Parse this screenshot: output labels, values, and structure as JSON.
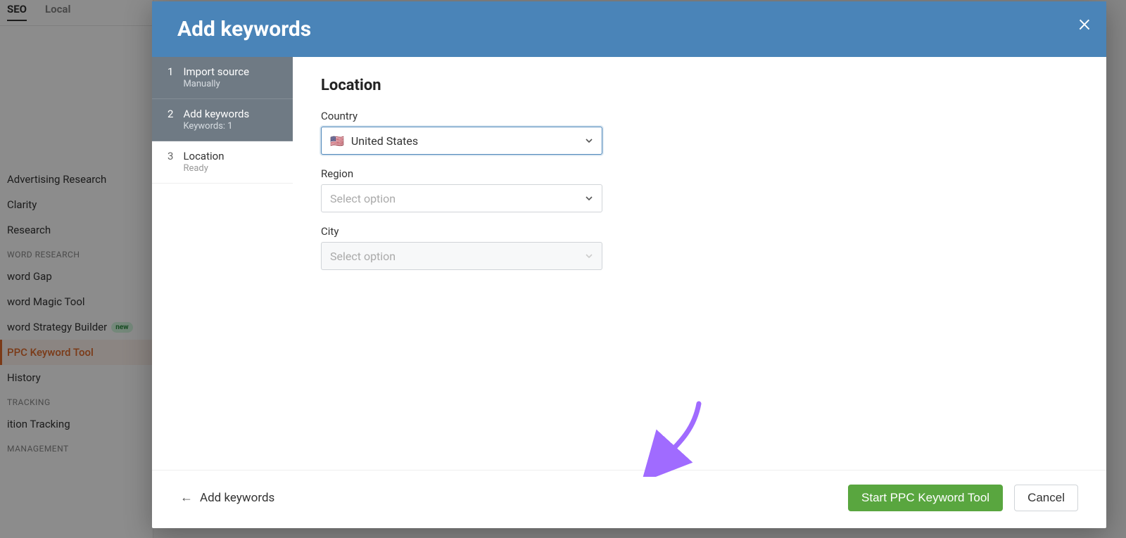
{
  "sidebar": {
    "tabs": {
      "seo": "SEO",
      "local": "Local"
    },
    "research_items": {
      "advertising": "Advertising Research",
      "clarity": "Clarity",
      "research": "Research"
    },
    "section_keyword": "WORD RESEARCH",
    "keyword_items": {
      "gap": "word Gap",
      "magic": "word Magic Tool",
      "strategy": "word Strategy Builder",
      "strategy_badge": "new",
      "ppc": "PPC Keyword Tool",
      "history": "History"
    },
    "section_tracking": "TRACKING",
    "tracking_items": {
      "position": "ition Tracking"
    },
    "section_management": "MANAGEMENT"
  },
  "modal": {
    "title": "Add keywords",
    "steps": [
      {
        "num": "1",
        "title": "Import source",
        "sub": "Manually"
      },
      {
        "num": "2",
        "title": "Add keywords",
        "sub": "Keywords: 1"
      },
      {
        "num": "3",
        "title": "Location",
        "sub": "Ready"
      }
    ],
    "form": {
      "heading": "Location",
      "country_label": "Country",
      "country_value": "United States",
      "region_label": "Region",
      "region_placeholder": "Select option",
      "city_label": "City",
      "city_placeholder": "Select option"
    },
    "footer": {
      "back": "Add keywords",
      "primary": "Start PPC Keyword Tool",
      "cancel": "Cancel"
    }
  }
}
